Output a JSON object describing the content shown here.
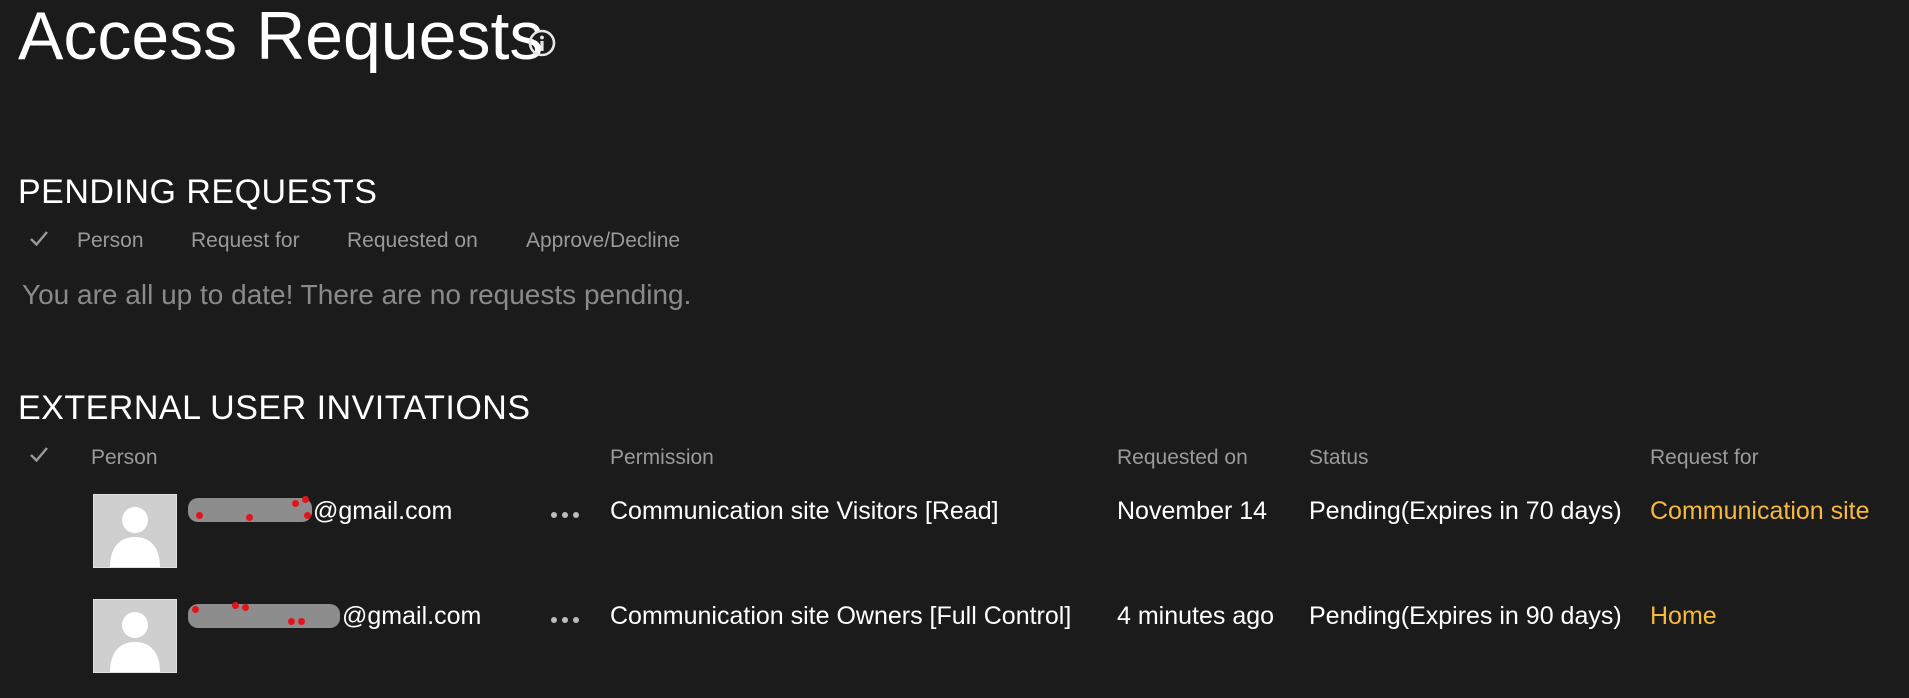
{
  "header": {
    "title": "Access Requests",
    "info_icon": "info-circle-icon"
  },
  "pending": {
    "title": "PENDING REQUESTS",
    "columns": {
      "check_icon": "checkmark-icon",
      "person": "Person",
      "request_for": "Request for",
      "requested_on": "Requested on",
      "approve_decline": "Approve/Decline"
    },
    "empty_message": "You are all up to date! There are no requests pending."
  },
  "external": {
    "title": "EXTERNAL USER INVITATIONS",
    "columns": {
      "check_icon": "checkmark-icon",
      "person": "Person",
      "permission": "Permission",
      "requested_on": "Requested on",
      "status": "Status",
      "request_for": "Request for"
    },
    "rows": [
      {
        "avatar_icon": "person-placeholder-icon",
        "email_suffix": "@gmail.com",
        "more_icon": "ellipsis-icon",
        "permission": "Communication site Visitors [Read]",
        "requested_on": "November 14",
        "status": "Pending(Expires in 70 days)",
        "request_for": "Communication site"
      },
      {
        "avatar_icon": "person-placeholder-icon",
        "email_suffix": "@gmail.com",
        "more_icon": "ellipsis-icon",
        "permission": "Communication site Owners [Full Control]",
        "requested_on": "4 minutes ago",
        "status": "Pending(Expires in 90 days)",
        "request_for": "Home"
      }
    ]
  },
  "colors": {
    "background": "#1c1b1b",
    "text": "#ffffff",
    "muted": "#9a9a9a",
    "link": "#f7b93c"
  }
}
